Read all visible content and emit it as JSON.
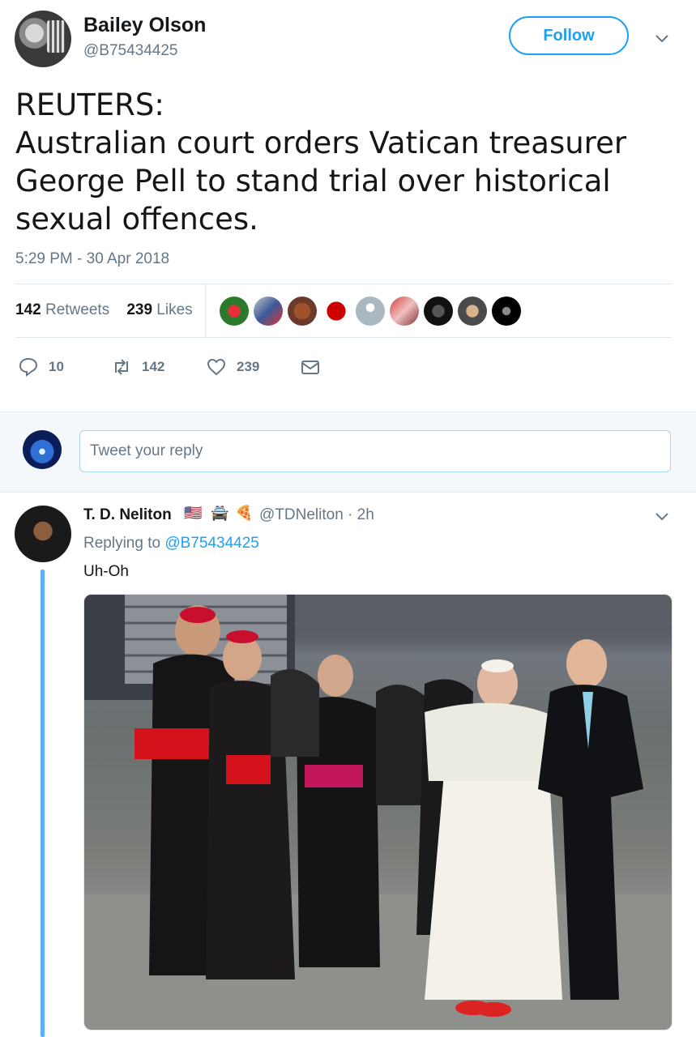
{
  "tweet": {
    "display_name": "Bailey Olson",
    "handle": "@B75434425",
    "follow_label": "Follow",
    "text": "REUTERS:\nAustralian court orders Vatican treasurer George Pell to stand trial over historical sexual offences.",
    "timestamp": "5:29 PM - 30 Apr 2018",
    "retweets_count": "142",
    "retweets_label": "Retweets",
    "likes_count": "239",
    "likes_label": "Likes"
  },
  "actions": {
    "reply_count": "10",
    "retweet_count": "142",
    "like_count": "239"
  },
  "reply_box": {
    "placeholder": "Tweet your reply"
  },
  "reply": {
    "display_name": "T. D. Neliton",
    "emojis": [
      "🇺🇸",
      "🚔",
      "🍕"
    ],
    "handle_time": "@TDNeliton · 2h",
    "replying_prefix": "Replying to",
    "replying_to": "@B75434425",
    "text": "Uh-Oh"
  },
  "colors": {
    "accent": "#1da1f2",
    "muted": "#657786",
    "thread_line": "#5ab3ec"
  }
}
